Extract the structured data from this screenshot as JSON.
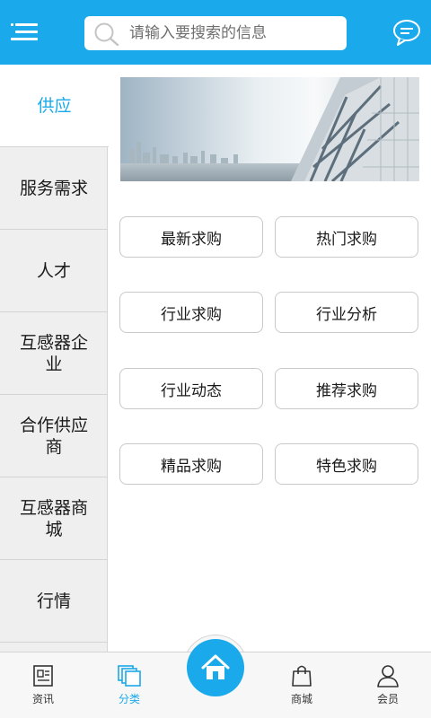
{
  "header": {
    "search_placeholder": "请输入要搜索的信息"
  },
  "sidebar": {
    "items": [
      {
        "label": "供应",
        "active": true
      },
      {
        "label": "服务需求"
      },
      {
        "label": "人才"
      },
      {
        "label": "互感器企业"
      },
      {
        "label": "合作供应商"
      },
      {
        "label": "互感器商城"
      },
      {
        "label": "行情"
      }
    ]
  },
  "main": {
    "buttons": [
      "最新求购",
      "热门求购",
      "行业求购",
      "行业分析",
      "行业动态",
      "推荐求购",
      "精品求购",
      "特色求购"
    ]
  },
  "bottom_nav": {
    "items": [
      {
        "label": "资讯",
        "icon": "newspaper-icon"
      },
      {
        "label": "分类",
        "icon": "category-icon",
        "active": true
      },
      {
        "label": "商城",
        "icon": "shopping-bag-icon"
      },
      {
        "label": "会员",
        "icon": "user-icon"
      }
    ],
    "home_icon": "home-icon"
  },
  "colors": {
    "accent": "#1aa9ea",
    "sidebar_bg": "#efefef"
  }
}
